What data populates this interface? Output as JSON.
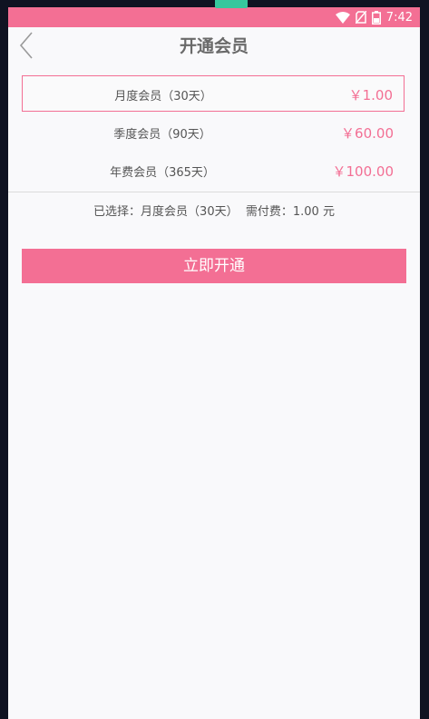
{
  "status_bar": {
    "time": "7:42",
    "icons": [
      "wifi-icon",
      "no-sim-icon",
      "battery-icon"
    ]
  },
  "header": {
    "title": "开通会员",
    "back_icon": "chevron-left-icon"
  },
  "plans": [
    {
      "name": "月度会员（30天）",
      "price": "￥1.00",
      "selected": true
    },
    {
      "name": "季度会员（90天）",
      "price": "￥60.00",
      "selected": false
    },
    {
      "name": "年费会员（365天）",
      "price": "￥100.00",
      "selected": false
    }
  ],
  "summary": {
    "selected_label": "已选择：",
    "selected_value": "月度会员（30天）",
    "pay_label": "需付费：",
    "pay_value": "1.00 元"
  },
  "action": {
    "label": "立即开通"
  },
  "colors": {
    "accent": "#f36f94",
    "background": "#f9f9fb",
    "text": "#555555"
  }
}
